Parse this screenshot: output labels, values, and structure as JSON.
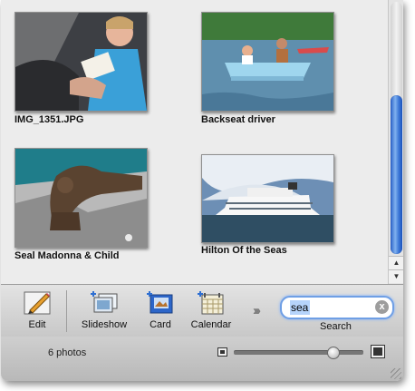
{
  "photos": [
    {
      "caption": "IMG_1351.JPG"
    },
    {
      "caption": "Backseat driver"
    },
    {
      "caption": "Seal Madonna & Child"
    },
    {
      "caption": "Hilton Of the Seas"
    }
  ],
  "toolbar": {
    "edit_label": "Edit",
    "slideshow_label": "Slideshow",
    "card_label": "Card",
    "calendar_label": "Calendar"
  },
  "search": {
    "value": "sea",
    "label": "Search",
    "clear_icon": "x"
  },
  "status": {
    "photo_count": "6 photos"
  },
  "zoom": {
    "level": 0.76
  },
  "scrollbar": {
    "position": 0.35,
    "visible_fraction": 0.63
  },
  "colors": {
    "accent": "#3b76d6",
    "selection": "#b6d4fb"
  }
}
